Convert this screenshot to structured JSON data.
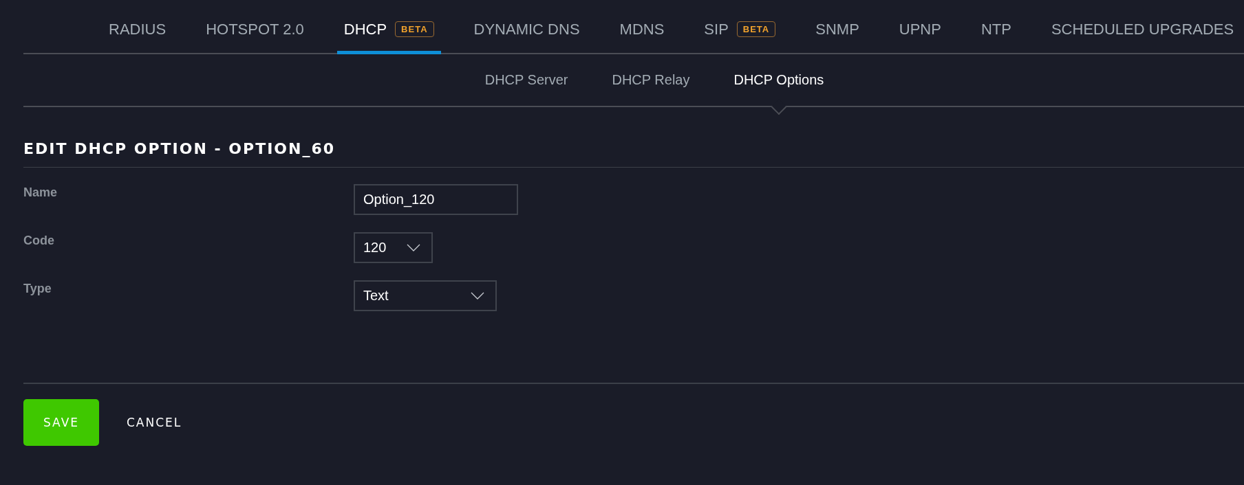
{
  "tabs": [
    {
      "label": "RADIUS",
      "selected": false
    },
    {
      "label": "HOTSPOT 2.0",
      "selected": false
    },
    {
      "label": "DHCP",
      "badge": "BETA",
      "selected": true
    },
    {
      "label": "DYNAMIC DNS",
      "selected": false
    },
    {
      "label": "MDNS",
      "selected": false
    },
    {
      "label": "SIP",
      "badge": "BETA",
      "selected": false
    },
    {
      "label": "SNMP",
      "selected": false
    },
    {
      "label": "UPNP",
      "selected": false
    },
    {
      "label": "NTP",
      "selected": false
    },
    {
      "label": "SCHEDULED UPGRADES",
      "selected": false
    }
  ],
  "subtabs": [
    {
      "label": "DHCP Server",
      "selected": false
    },
    {
      "label": "DHCP Relay",
      "selected": false
    },
    {
      "label": "DHCP Options",
      "selected": true
    }
  ],
  "form": {
    "title": "EDIT DHCP OPTION - OPTION_60",
    "fields": [
      {
        "label": "Name",
        "kind": "text",
        "value": "Option_120"
      },
      {
        "label": "Code",
        "kind": "select",
        "value": "120"
      },
      {
        "label": "Type",
        "kind": "select",
        "value": "Text"
      }
    ]
  },
  "buttons": [
    {
      "label": "SAVE",
      "kind": "primary"
    },
    {
      "label": "CANCEL",
      "kind": "plain"
    }
  ]
}
